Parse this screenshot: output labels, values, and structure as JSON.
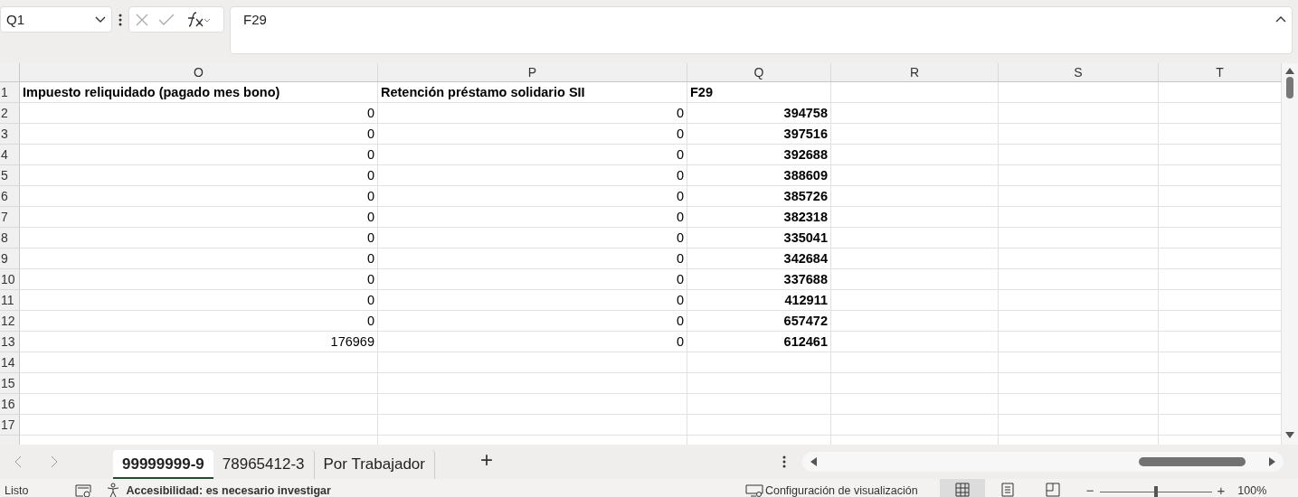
{
  "name_box": {
    "value": "Q1"
  },
  "formula_bar": {
    "value": "F29"
  },
  "columns": [
    {
      "label": "O"
    },
    {
      "label": "P"
    },
    {
      "label": "Q"
    },
    {
      "label": "R"
    },
    {
      "label": "S"
    },
    {
      "label": "T"
    }
  ],
  "rows": [
    {
      "number": "1",
      "kind": "header",
      "cells": [
        {
          "text": "Impuesto reliquidado (pagado mes bono)",
          "bold": true
        },
        {
          "text": "Retención préstamo solidario SII",
          "bold": true
        },
        {
          "text": "F29",
          "bold": true
        }
      ]
    },
    {
      "number": "2",
      "kind": "data",
      "cells": [
        {
          "text": "0",
          "bold": false
        },
        {
          "text": "0",
          "bold": false
        },
        {
          "text": "394758",
          "bold": true
        }
      ]
    },
    {
      "number": "3",
      "kind": "data",
      "cells": [
        {
          "text": "0",
          "bold": false
        },
        {
          "text": "0",
          "bold": false
        },
        {
          "text": "397516",
          "bold": true
        }
      ]
    },
    {
      "number": "4",
      "kind": "data",
      "cells": [
        {
          "text": "0",
          "bold": false
        },
        {
          "text": "0",
          "bold": false
        },
        {
          "text": "392688",
          "bold": true
        }
      ]
    },
    {
      "number": "5",
      "kind": "data",
      "cells": [
        {
          "text": "0",
          "bold": false
        },
        {
          "text": "0",
          "bold": false
        },
        {
          "text": "388609",
          "bold": true
        }
      ]
    },
    {
      "number": "6",
      "kind": "data",
      "cells": [
        {
          "text": "0",
          "bold": false
        },
        {
          "text": "0",
          "bold": false
        },
        {
          "text": "385726",
          "bold": true
        }
      ]
    },
    {
      "number": "7",
      "kind": "data",
      "cells": [
        {
          "text": "0",
          "bold": false
        },
        {
          "text": "0",
          "bold": false
        },
        {
          "text": "382318",
          "bold": true
        }
      ]
    },
    {
      "number": "8",
      "kind": "data",
      "cells": [
        {
          "text": "0",
          "bold": false
        },
        {
          "text": "0",
          "bold": false
        },
        {
          "text": "335041",
          "bold": true
        }
      ]
    },
    {
      "number": "9",
      "kind": "data",
      "cells": [
        {
          "text": "0",
          "bold": false
        },
        {
          "text": "0",
          "bold": false
        },
        {
          "text": "342684",
          "bold": true
        }
      ]
    },
    {
      "number": "10",
      "kind": "data",
      "cells": [
        {
          "text": "0",
          "bold": false
        },
        {
          "text": "0",
          "bold": false
        },
        {
          "text": "337688",
          "bold": true
        }
      ]
    },
    {
      "number": "11",
      "kind": "data",
      "cells": [
        {
          "text": "0",
          "bold": false
        },
        {
          "text": "0",
          "bold": false
        },
        {
          "text": "412911",
          "bold": true
        }
      ]
    },
    {
      "number": "12",
      "kind": "data",
      "cells": [
        {
          "text": "0",
          "bold": false
        },
        {
          "text": "0",
          "bold": false
        },
        {
          "text": "657472",
          "bold": true
        }
      ]
    },
    {
      "number": "13",
      "kind": "data",
      "cells": [
        {
          "text": "176969",
          "bold": false
        },
        {
          "text": "0",
          "bold": false
        },
        {
          "text": "612461",
          "bold": true
        }
      ]
    },
    {
      "number": "14",
      "cells": []
    },
    {
      "number": "15",
      "cells": []
    },
    {
      "number": "16",
      "cells": []
    },
    {
      "number": "17",
      "cells": []
    }
  ],
  "sheet_tabs": [
    {
      "label": "99999999-9",
      "selected": true
    },
    {
      "label": "78965412-3",
      "selected": false
    },
    {
      "label": "Por Trabajador",
      "selected": false
    }
  ],
  "add_sheet": {
    "label": "+"
  },
  "status_bar": {
    "ready": "Listo",
    "accessibility": "Accesibilidad: es necesario investigar",
    "display_settings": "Configuración de visualización",
    "views": [
      {
        "kind": "normal",
        "selected": true
      },
      {
        "kind": "page-layout",
        "selected": false
      },
      {
        "kind": "page-break",
        "selected": false
      }
    ],
    "zoom": {
      "minus": "−",
      "plus": "+",
      "level": 0.5,
      "reading": "100%"
    }
  }
}
